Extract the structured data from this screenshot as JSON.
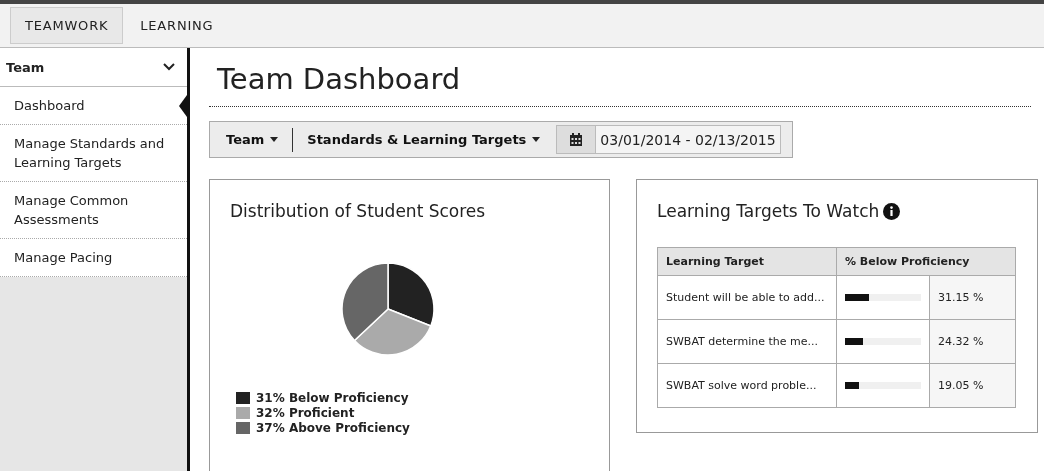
{
  "top_tabs": [
    {
      "label": "TEAMWORK",
      "selected": true
    },
    {
      "label": "LEARNING",
      "selected": false
    }
  ],
  "sidebar": {
    "header": "Team",
    "expanded": true,
    "items": [
      {
        "label": "Dashboard",
        "selected": true
      },
      {
        "label": "Manage Standards and Learning Targets",
        "selected": false
      },
      {
        "label": "Manage Common Assessments",
        "selected": false
      },
      {
        "label": "Manage Pacing",
        "selected": false
      }
    ]
  },
  "page_title": "Team Dashboard",
  "filters": {
    "team": "Team",
    "standards": "Standards & Learning Targets",
    "date_range": "03/01/2014 - 02/13/2015"
  },
  "distribution": {
    "title": "Distribution of Student Scores",
    "chart_data": {
      "type": "pie",
      "values": [
        31,
        32,
        37
      ]
    },
    "legend": [
      {
        "label": "31% Below Proficiency",
        "color": "#222222"
      },
      {
        "label": "32% Proficient",
        "color": "#aaaaaa"
      },
      {
        "label": "37% Above Proficiency",
        "color": "#666666"
      }
    ]
  },
  "targets": {
    "title": "Learning Targets To Watch",
    "columns": [
      "Learning Target",
      "% Below Proficiency"
    ],
    "rows": [
      {
        "target": "Student will be able to add...",
        "level": 0.3115,
        "percent": "31.15 %"
      },
      {
        "target": "SWBAT determine the me...",
        "level": 0.2432,
        "percent": "24.32 %"
      },
      {
        "target": "SWBAT solve word proble...",
        "level": 0.1905,
        "percent": "19.05 %"
      }
    ]
  }
}
